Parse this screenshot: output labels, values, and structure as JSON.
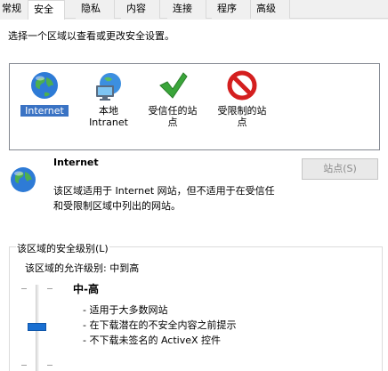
{
  "tabs": [
    {
      "label": "常规",
      "active": false
    },
    {
      "label": "安全",
      "active": true
    },
    {
      "label": "隐私",
      "active": false
    },
    {
      "label": "内容",
      "active": false
    },
    {
      "label": "连接",
      "active": false
    },
    {
      "label": "程序",
      "active": false
    },
    {
      "label": "高级",
      "active": false
    }
  ],
  "instruction": "选择一个区域以查看或更改安全设置。",
  "zones": [
    {
      "icon": "globe-icon",
      "label": "Internet",
      "selected": true
    },
    {
      "icon": "intranet-computer-icon",
      "label_lines": [
        "本地",
        "Intranet"
      ],
      "selected": false
    },
    {
      "icon": "green-checkmark-icon",
      "label_lines": [
        "受信任的站",
        "点"
      ],
      "selected": false
    },
    {
      "icon": "restricted-red-circle-icon",
      "label_lines": [
        "受限制的站",
        "点"
      ],
      "selected": false
    }
  ],
  "zone_info": {
    "title": "Internet",
    "description_lines": [
      "该区域适用于 Internet 网站，但不适用于在受信任",
      "和受限制区域中列出的网站。"
    ],
    "sites_button": "站点(S)",
    "sites_button_enabled": false
  },
  "security_level": {
    "group_title": "该区域的安全级别(L)",
    "allowed_levels": "该区域的允许级别: 中到高",
    "level_name": "中-高",
    "bullets": [
      "- 适用于大多数网站",
      "- 在下载潜在的不安全内容之前提示",
      "- 不下载未签名的 ActiveX 控件"
    ]
  },
  "colors": {
    "selection": "#3a73c4",
    "slider_thumb": "#1a6fd1"
  }
}
